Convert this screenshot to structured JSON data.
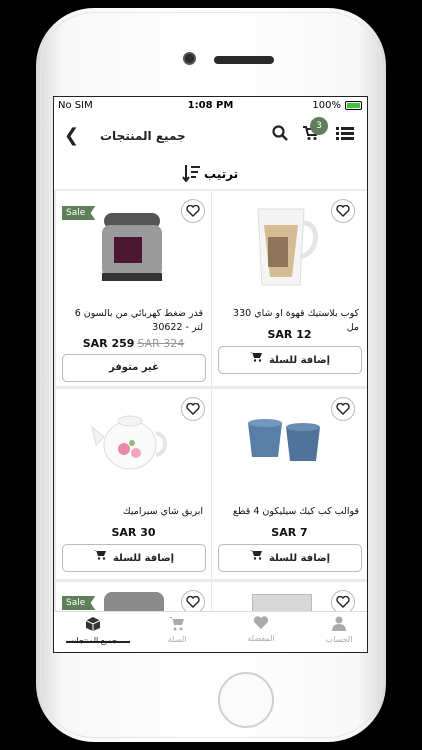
{
  "status": {
    "carrier": "No SIM",
    "time": "1:08 PM",
    "battery": "100%"
  },
  "header": {
    "title": "جميع المنتجات",
    "cart_count": "3"
  },
  "sort": {
    "label": "ترتيب"
  },
  "products": [
    {
      "name": "قدر ضغط كهربائي من بالسون 6 لتر - 30622",
      "price": "SAR 259",
      "old_price": "SAR 324",
      "sale": "Sale",
      "action": "غير متوفر"
    },
    {
      "name": "كوب بلاستيك قهوة او شاي 330 مل",
      "price": "SAR 12",
      "action": "إضافة للسلة"
    },
    {
      "name": "ابريق شاي سيراميك",
      "price": "SAR 30",
      "action": "إضافة للسلة"
    },
    {
      "name": "قوالب كب كيك سيليكون 4 قطع",
      "price": "SAR 7",
      "action": "إضافة للسلة"
    },
    {
      "sale": "Sale"
    }
  ],
  "tabs": [
    {
      "label": "جميع المنتجات",
      "icon": "box-icon"
    },
    {
      "label": "السلة",
      "icon": "cart-icon"
    },
    {
      "label": "المفضلة",
      "icon": "heart-icon"
    },
    {
      "label": "الحساب",
      "icon": "user-icon"
    }
  ],
  "colors": {
    "accent": "#5f7f5b",
    "battery": "#3cc13b"
  }
}
